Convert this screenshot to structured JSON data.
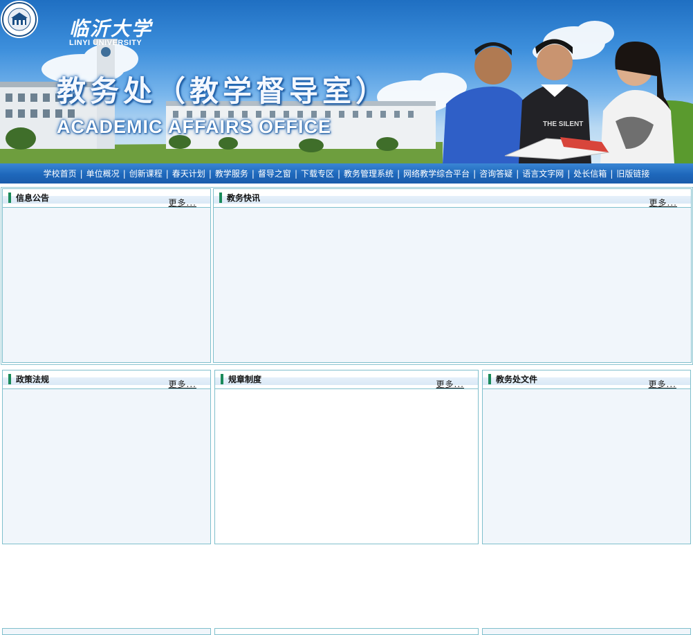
{
  "header": {
    "logo_cn": "临沂大学",
    "logo_en": "LINYI UNIVERSITY",
    "title_cn": "教务处（教学督导室）",
    "title_en": "ACADEMIC AFFAIRS OFFICE"
  },
  "nav": {
    "items": [
      "学校首页",
      "单位概况",
      "创新课程",
      "春天计划",
      "教学服务",
      "督导之窗",
      "下载专区",
      "教务管理系统",
      "网络教学综合平台",
      "咨询答疑",
      "语言文字网",
      "处长信箱",
      "旧版链接"
    ],
    "separator": "|"
  },
  "panels": {
    "notice": {
      "title": "信息公告",
      "more": "更多..."
    },
    "news": {
      "title": "教务快讯",
      "more": "更多..."
    },
    "policy": {
      "title": "政策法规",
      "more": "更多..."
    },
    "rules": {
      "title": "规章制度",
      "more": "更多..."
    },
    "files": {
      "title": "教务处文件",
      "more": "更多..."
    }
  },
  "colors": {
    "nav_bg": "#1e67bb",
    "panel_border": "#7fbfcc",
    "panel_bg": "#f1f6fb",
    "title_bar": "#1a8a5a"
  }
}
